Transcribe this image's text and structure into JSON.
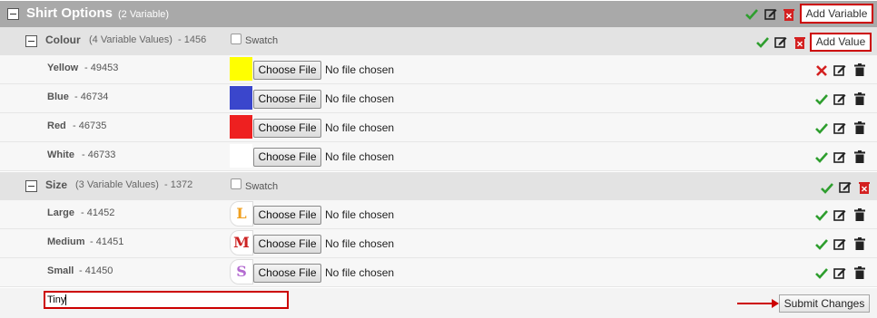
{
  "colors": {
    "check": "#2e9e2e",
    "delete": "#d32020",
    "accent_border": "#cc0000"
  },
  "variable": {
    "title": "Shirt Options",
    "note": "(2 Variable)",
    "add_variable_label": "Add Variable"
  },
  "groups": [
    {
      "name": "Colour",
      "note": "(4 Variable Values)",
      "id": "- 1456",
      "swatch_label": "Swatch",
      "add_value_label": "Add Value",
      "values": [
        {
          "name": "Yellow",
          "id": "- 49453",
          "swatch": "#ffff00",
          "file_button": "Choose File",
          "file_status": "No file chosen",
          "status_icon": "x-icon"
        },
        {
          "name": "Blue",
          "id": "- 46734",
          "swatch": "#3a46cc",
          "file_button": "Choose File",
          "file_status": "No file chosen",
          "status_icon": "check-icon"
        },
        {
          "name": "Red",
          "id": "- 46735",
          "swatch": "#ee2020",
          "file_button": "Choose File",
          "file_status": "No file chosen",
          "status_icon": "check-icon"
        },
        {
          "name": "White",
          "id": "- 46733",
          "swatch": "#ffffff",
          "file_button": "Choose File",
          "file_status": "No file chosen",
          "status_icon": "check-icon"
        }
      ]
    },
    {
      "name": "Size",
      "note": "(3 Variable Values)",
      "id": "- 1372",
      "swatch_label": "Swatch",
      "values": [
        {
          "name": "Large",
          "id": "- 41452",
          "letter": "L",
          "letter_color": "#f0a020",
          "file_button": "Choose File",
          "file_status": "No file chosen",
          "status_icon": "check-icon"
        },
        {
          "name": "Medium",
          "id": "- 41451",
          "letter": "M",
          "letter_color": "#cc2222",
          "file_button": "Choose File",
          "file_status": "No file chosen",
          "status_icon": "check-icon"
        },
        {
          "name": "Small",
          "id": "- 41450",
          "letter": "S",
          "letter_color": "#b36ad0",
          "file_button": "Choose File",
          "file_status": "No file chosen",
          "status_icon": "check-icon"
        }
      ]
    }
  ],
  "new_value_input": "Tiny",
  "submit_label": "Submit Changes"
}
